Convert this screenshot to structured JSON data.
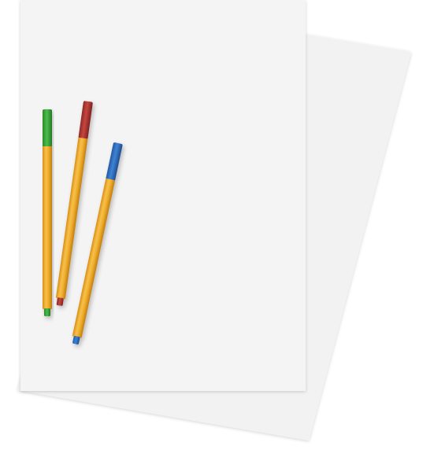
{
  "scene": {
    "background_color": "#ffffff",
    "paper_color": "#f4f4f4",
    "paper_back_color": "#f2f2f2",
    "sheets": [
      {
        "name": "back-sheet",
        "color": "#f2f2f2"
      },
      {
        "name": "front-sheet",
        "color": "#f4f4f4"
      }
    ],
    "pens": [
      {
        "name": "green",
        "cap_color": "#3aa53a",
        "body_color": "#f0b030"
      },
      {
        "name": "red",
        "cap_color": "#b53a36",
        "body_color": "#f0b030"
      },
      {
        "name": "blue",
        "cap_color": "#2f6fc0",
        "body_color": "#f0b030"
      }
    ]
  }
}
